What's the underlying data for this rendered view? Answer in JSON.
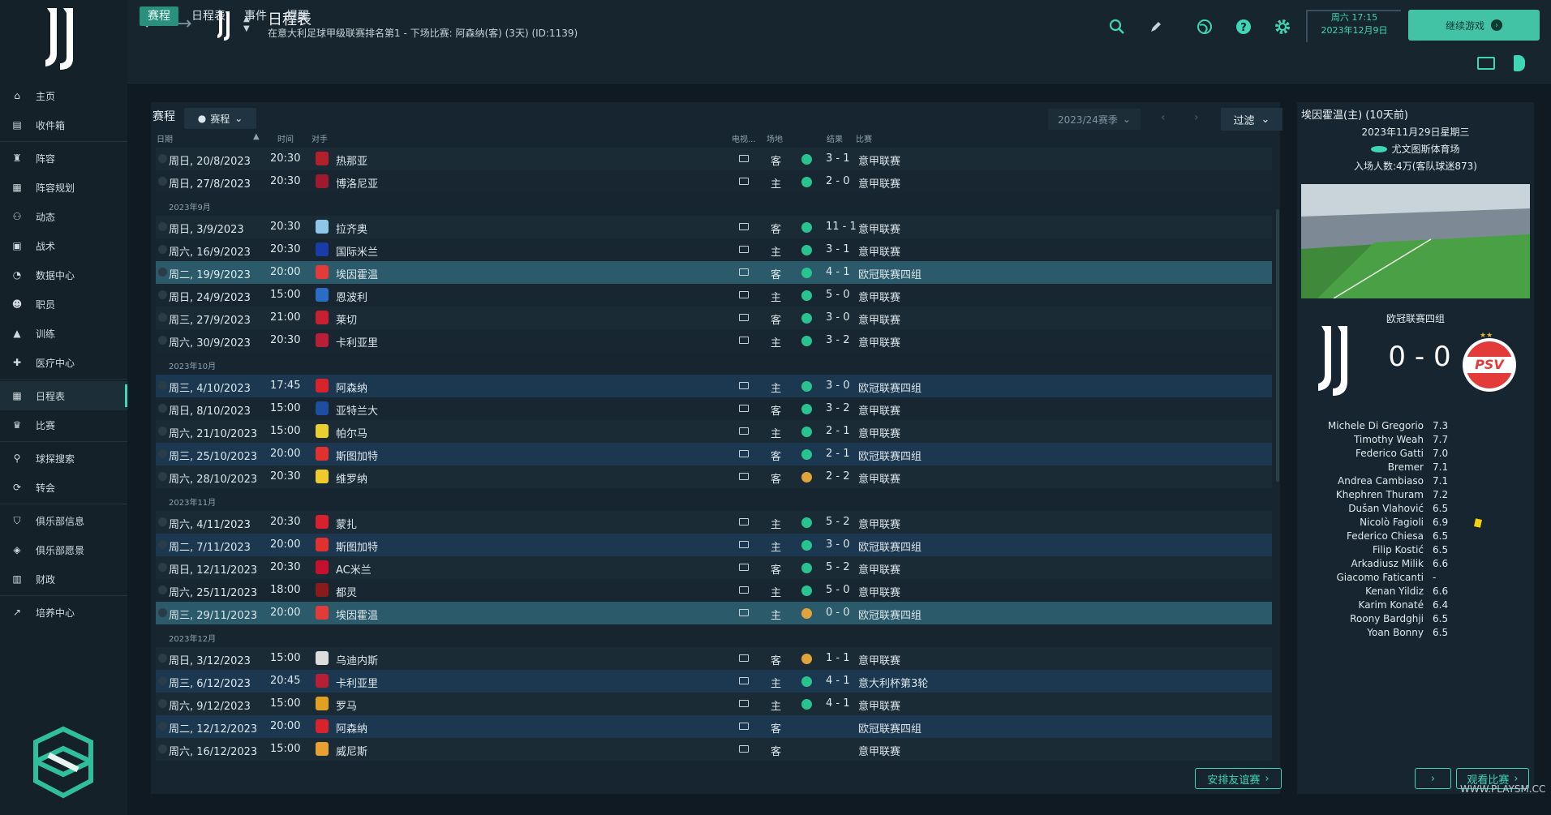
{
  "sidebar": {
    "items": [
      {
        "label": "主页",
        "icon": "home-icon"
      },
      {
        "label": "收件箱",
        "icon": "inbox-icon"
      },
      {
        "label": "阵容",
        "icon": "shirt-icon"
      },
      {
        "label": "阵容规划",
        "icon": "clipboard-icon"
      },
      {
        "label": "动态",
        "icon": "people-icon"
      },
      {
        "label": "战术",
        "icon": "tactics-icon"
      },
      {
        "label": "数据中心",
        "icon": "pie-icon"
      },
      {
        "label": "职员",
        "icon": "staff-icon"
      },
      {
        "label": "训练",
        "icon": "training-icon"
      },
      {
        "label": "医疗中心",
        "icon": "medical-icon"
      },
      {
        "label": "日程表",
        "icon": "calendar-icon"
      },
      {
        "label": "比赛",
        "icon": "trophy-icon"
      },
      {
        "label": "球探搜索",
        "icon": "search-icon"
      },
      {
        "label": "转会",
        "icon": "transfer-icon"
      },
      {
        "label": "俱乐部信息",
        "icon": "shield-icon"
      },
      {
        "label": "俱乐部愿景",
        "icon": "vision-icon"
      },
      {
        "label": "财政",
        "icon": "money-icon"
      },
      {
        "label": "培养中心",
        "icon": "development-icon"
      }
    ]
  },
  "header": {
    "title": "日程表",
    "subtitle": "在意大利足球甲级联赛排名第1 - 下场比赛: 阿森纳(客) (3天) (ID:1139)",
    "datetime_line1": "周六 17:15",
    "datetime_line2": "2023年12月9日",
    "continue_label": "继续游戏"
  },
  "tabs": [
    "赛程",
    "日程表",
    "事件",
    "提醒"
  ],
  "fixtures": {
    "heading": "赛程",
    "view_dropdown": "赛程",
    "season": "2023/24赛季",
    "filter_label": "过滤",
    "columns": {
      "date": "日期",
      "time": "时间",
      "opponent": "对手",
      "tv": "电视...",
      "venue": "场地",
      "result": "结果",
      "competition": "比赛"
    },
    "rows": [
      {
        "date": "周日, 20/8/2023",
        "time": "20:30",
        "opp": "热那亚",
        "venue": "客",
        "result": "3 - 1",
        "comp": "意甲联赛",
        "outcome": "win",
        "crest": "#b4202a"
      },
      {
        "date": "周日, 27/8/2023",
        "time": "20:30",
        "opp": "博洛尼亚",
        "venue": "主",
        "result": "2 - 0",
        "comp": "意甲联赛",
        "outcome": "win",
        "crest": "#a01a2e"
      },
      {
        "month": "2023年9月"
      },
      {
        "date": "周日, 3/9/2023",
        "time": "20:30",
        "opp": "拉齐奥",
        "venue": "客",
        "result": "11 - 1",
        "comp": "意甲联赛",
        "outcome": "win",
        "crest": "#8fc6e8"
      },
      {
        "date": "周六, 16/9/2023",
        "time": "20:30",
        "opp": "国际米兰",
        "venue": "主",
        "result": "3 - 1",
        "comp": "意甲联赛",
        "outcome": "win",
        "crest": "#1a3ca8"
      },
      {
        "date": "周二, 19/9/2023",
        "time": "20:00",
        "opp": "埃因霍温",
        "venue": "客",
        "result": "4 - 1",
        "comp": "欧冠联赛四组",
        "outcome": "win",
        "crest": "#e33a3a",
        "style": "hl2"
      },
      {
        "date": "周日, 24/9/2023",
        "time": "15:00",
        "opp": "恩波利",
        "venue": "主",
        "result": "5 - 0",
        "comp": "意甲联赛",
        "outcome": "win",
        "crest": "#2b6cc4"
      },
      {
        "date": "周三, 27/9/2023",
        "time": "21:00",
        "opp": "莱切",
        "venue": "客",
        "result": "3 - 0",
        "comp": "意甲联赛",
        "outcome": "win",
        "crest": "#c8202e"
      },
      {
        "date": "周六, 30/9/2023",
        "time": "20:30",
        "opp": "卡利亚里",
        "venue": "主",
        "result": "3 - 2",
        "comp": "意甲联赛",
        "outcome": "win",
        "crest": "#b81e36"
      },
      {
        "month": "2023年10月"
      },
      {
        "date": "周三, 4/10/2023",
        "time": "17:45",
        "opp": "阿森纳",
        "venue": "主",
        "result": "3 - 0",
        "comp": "欧冠联赛四组",
        "outcome": "win",
        "crest": "#d9222b",
        "style": "hl"
      },
      {
        "date": "周日, 8/10/2023",
        "time": "15:00",
        "opp": "亚特兰大",
        "venue": "客",
        "result": "3 - 2",
        "comp": "意甲联赛",
        "outcome": "win",
        "crest": "#1d4fa0"
      },
      {
        "date": "周六, 21/10/2023",
        "time": "15:00",
        "opp": "帕尔马",
        "venue": "主",
        "result": "2 - 1",
        "comp": "意甲联赛",
        "outcome": "win",
        "crest": "#e8d02e"
      },
      {
        "date": "周三, 25/10/2023",
        "time": "20:00",
        "opp": "斯图加特",
        "venue": "客",
        "result": "2 - 1",
        "comp": "欧冠联赛四组",
        "outcome": "win",
        "crest": "#e03030",
        "style": "hl"
      },
      {
        "date": "周六, 28/10/2023",
        "time": "20:30",
        "opp": "维罗纳",
        "venue": "客",
        "result": "2 - 2",
        "comp": "意甲联赛",
        "outcome": "draw",
        "crest": "#f0c92a"
      },
      {
        "month": "2023年11月"
      },
      {
        "date": "周六, 4/11/2023",
        "time": "20:30",
        "opp": "蒙扎",
        "venue": "主",
        "result": "5 - 2",
        "comp": "意甲联赛",
        "outcome": "win",
        "crest": "#d8202e"
      },
      {
        "date": "周二, 7/11/2023",
        "time": "20:00",
        "opp": "斯图加特",
        "venue": "主",
        "result": "3 - 0",
        "comp": "欧冠联赛四组",
        "outcome": "win",
        "crest": "#e03030",
        "style": "hl"
      },
      {
        "date": "周日, 12/11/2023",
        "time": "20:30",
        "opp": "AC米兰",
        "venue": "客",
        "result": "5 - 2",
        "comp": "意甲联赛",
        "outcome": "win",
        "crest": "#c8102e"
      },
      {
        "date": "周六, 25/11/2023",
        "time": "18:00",
        "opp": "都灵",
        "venue": "主",
        "result": "5 - 0",
        "comp": "意甲联赛",
        "outcome": "win",
        "crest": "#8b1a1a"
      },
      {
        "date": "周三, 29/11/2023",
        "time": "20:00",
        "opp": "埃因霍温",
        "venue": "主",
        "result": "0 - 0",
        "comp": "欧冠联赛四组",
        "outcome": "draw",
        "crest": "#e33a3a",
        "style": "cur"
      },
      {
        "month": "2023年12月"
      },
      {
        "date": "周日, 3/12/2023",
        "time": "15:00",
        "opp": "乌迪内斯",
        "venue": "客",
        "result": "1 - 1",
        "comp": "意甲联赛",
        "outcome": "draw",
        "crest": "#dddddd"
      },
      {
        "date": "周三, 6/12/2023",
        "time": "20:45",
        "opp": "卡利亚里",
        "venue": "主",
        "result": "4 - 1",
        "comp": "意大利杯第3轮",
        "outcome": "win",
        "crest": "#b81e36",
        "style": "hl"
      },
      {
        "date": "周六, 9/12/2023",
        "time": "15:00",
        "opp": "罗马",
        "venue": "主",
        "result": "4 - 1",
        "comp": "意甲联赛",
        "outcome": "win",
        "crest": "#e0a020"
      },
      {
        "date": "周二, 12/12/2023",
        "time": "20:00",
        "opp": "阿森纳",
        "venue": "客",
        "result": "",
        "comp": "欧冠联赛四组",
        "outcome": "",
        "crest": "#d9222b",
        "style": "hl"
      },
      {
        "date": "周六, 16/12/2023",
        "time": "15:00",
        "opp": "威尼斯",
        "venue": "客",
        "result": "",
        "comp": "意甲联赛",
        "outcome": "",
        "crest": "#e8a030"
      }
    ],
    "friendly_button": "安排友谊赛"
  },
  "match_panel": {
    "title": "埃因霍温(主) (10天前)",
    "date": "2023年11月29日星期三",
    "stadium": "尤文图斯体育场",
    "attendance": "入场人数:4万(客队球迷873)",
    "competition": "欧冠联赛四组",
    "score": "0 - 0",
    "away_badge_text": "PSV",
    "view_match_button": "观看比赛",
    "players": [
      {
        "name": "Michele Di Gregorio",
        "rating": "7.3"
      },
      {
        "name": "Timothy Weah",
        "rating": "7.7"
      },
      {
        "name": "Federico Gatti",
        "rating": "7.0"
      },
      {
        "name": "Bremer",
        "rating": "7.1"
      },
      {
        "name": "Andrea Cambiaso",
        "rating": "7.1"
      },
      {
        "name": "Khephren Thuram",
        "rating": "7.2"
      },
      {
        "name": "Dušan Vlahović",
        "rating": "6.5"
      },
      {
        "name": "Nicolò Fagioli",
        "rating": "6.9",
        "card": "yellow"
      },
      {
        "name": "Federico Chiesa",
        "rating": "6.5"
      },
      {
        "name": "Filip Kostić",
        "rating": "6.5"
      },
      {
        "name": "Arkadiusz Milik",
        "rating": "6.6"
      },
      {
        "name": "Giacomo Faticanti",
        "rating": "-"
      },
      {
        "name": "Kenan Yildiz",
        "rating": "6.6"
      },
      {
        "name": "Karim Konaté",
        "rating": "6.4"
      },
      {
        "name": "Roony Bardghji",
        "rating": "6.5"
      },
      {
        "name": "Yoan Bonny",
        "rating": "6.5"
      }
    ]
  },
  "watermark": "WWW.PLAYSM.CC",
  "colors": {
    "accent": "#3fd5b5",
    "win": "#29c38f",
    "draw": "#e1a33b",
    "highlight": "#1b3850",
    "current": "#2b5a6b"
  }
}
